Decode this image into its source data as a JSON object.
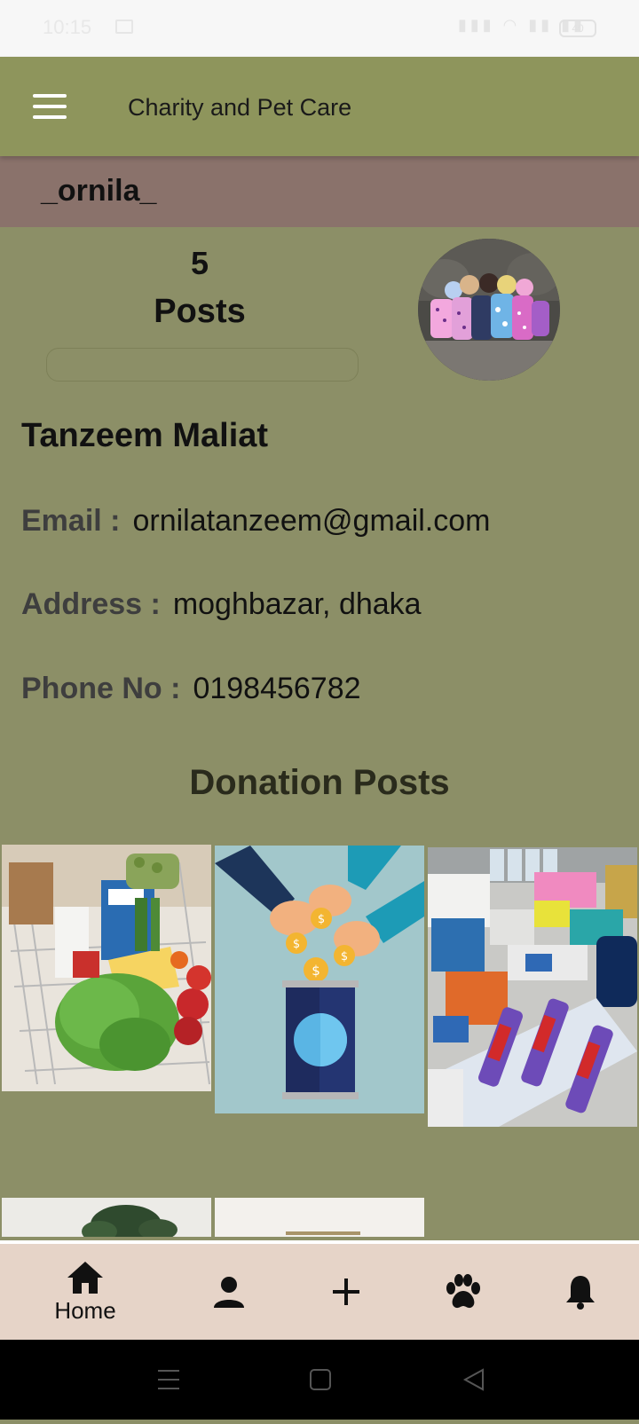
{
  "status_bar": {
    "time": "10:15",
    "battery": "40"
  },
  "app_bar": {
    "title": "Charity and Pet Care",
    "menu_icon": "hamburger-menu-icon"
  },
  "profile": {
    "username": "_ornila_",
    "posts_count": "5",
    "posts_label": "Posts",
    "full_name": "Tanzeem Maliat",
    "email_label": "Email :",
    "email": "ornilatanzeem@gmail.com",
    "address_label": "Address :",
    "address": "moghbazar, dhaka",
    "phone_label": "Phone No :",
    "phone": "0198456782"
  },
  "donation_section": {
    "title": "Donation Posts",
    "posts": [
      {
        "image": "grocery-cart-image"
      },
      {
        "image": "coin-donation-jar-image"
      },
      {
        "image": "toiletries-supplies-image"
      },
      {
        "image": "potted-plant-image"
      },
      {
        "image": "light-product-image"
      }
    ]
  },
  "bottom_nav": {
    "items": [
      {
        "icon": "home-icon",
        "label": "Home"
      },
      {
        "icon": "person-icon",
        "label": ""
      },
      {
        "icon": "plus-icon",
        "label": ""
      },
      {
        "icon": "paw-icon",
        "label": ""
      },
      {
        "icon": "bell-icon",
        "label": ""
      }
    ]
  },
  "colors": {
    "background": "#8c8f67",
    "app_bar": "#8e955c",
    "user_bar": "#8a726b",
    "bottom_nav": "#e6d4c8"
  }
}
